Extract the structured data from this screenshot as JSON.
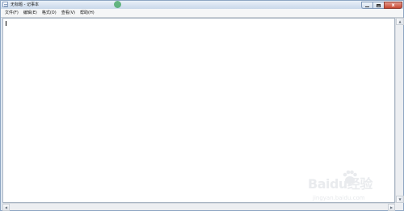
{
  "window": {
    "title": "无标题 - 记事本",
    "icon": "notepad-icon",
    "controls": {
      "minimize_icon": "minimize-icon",
      "maximize_icon": "maximize-icon",
      "close_icon": "close-icon",
      "close_label": "x"
    }
  },
  "menu": {
    "items": [
      {
        "label": "文件(F)"
      },
      {
        "label": "编辑(E)"
      },
      {
        "label": "格式(O)"
      },
      {
        "label": "查看(V)"
      },
      {
        "label": "帮助(H)"
      }
    ]
  },
  "editor": {
    "content": ""
  },
  "watermark": {
    "brand": "Baidu经验",
    "url": "jingyan.baidu.com"
  },
  "colors": {
    "window_border": "#8ea6c3",
    "titlebar_top": "#e9f0f8",
    "titlebar_bottom": "#c9d8ea",
    "menubar_bg": "#f5f6f7",
    "close_button": "#c64732"
  }
}
